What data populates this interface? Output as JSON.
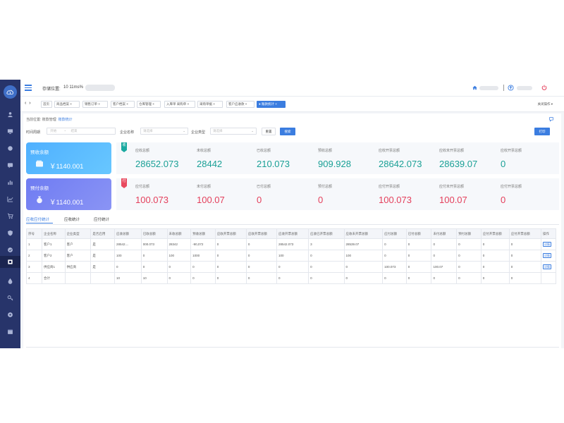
{
  "header": {
    "label": "存储位置:",
    "time": "10 11ms%",
    "user_name": ""
  },
  "tabbar": {
    "tabs": [
      "首页",
      "商品档案 ×",
      "销售订单 ×",
      "客户档案 ×",
      "仓库管理 ×",
      "入库单 采购单 ×",
      "采购单据 ×",
      "客户应收款 ×",
      "● 账款统计 ×"
    ],
    "close_all": "关闭操作 ▾"
  },
  "breadcrumb": {
    "label": "当前位置:",
    "parent": "账款管理",
    "current": "账款统计"
  },
  "filters": {
    "date_label": "时间周期",
    "date_start_placeholder": "开始",
    "date_sep": "-",
    "date_end_placeholder": "结束",
    "company_label": "企业名称",
    "company_placeholder": "请选择",
    "type_label": "企业类型",
    "type_placeholder": "请选择",
    "reset": "重置",
    "search": "搜索",
    "print": "打印"
  },
  "balances": [
    {
      "title": "预收余额",
      "amount": "￥1140.001",
      "icon": "wallet-icon"
    },
    {
      "title": "预付余额",
      "amount": "￥1140.001",
      "icon": "money-bag-icon"
    }
  ],
  "stats": {
    "receivable_badge": "收",
    "payable_badge": "付",
    "receivable": [
      {
        "label": "应收总额",
        "value": "28652.073"
      },
      {
        "label": "未收总额",
        "value": "28442"
      },
      {
        "label": "已收总额",
        "value": "210.073"
      },
      {
        "label": "预收总额",
        "value": "909.928"
      },
      {
        "label": "应收开票总额",
        "value": "28642.073"
      },
      {
        "label": "应收未开票总额",
        "value": "28639.07"
      },
      {
        "label": "应收开票总额",
        "value": "0"
      }
    ],
    "payable": [
      {
        "label": "应付总额",
        "value": "100.073"
      },
      {
        "label": "未付总额",
        "value": "100.07"
      },
      {
        "label": "已付总额",
        "value": "0"
      },
      {
        "label": "预付总额",
        "value": "0"
      },
      {
        "label": "应付开票总额",
        "value": "100.073"
      },
      {
        "label": "应付未开票总额",
        "value": "100.07"
      },
      {
        "label": "应付开票总额",
        "value": "0"
      }
    ]
  },
  "subtabs": [
    "应收应付统计",
    "应收统计",
    "应付统计"
  ],
  "table": {
    "columns": [
      "序号",
      "企业名称",
      "企业类型",
      "是否启用",
      "应收总额",
      "已收总额",
      "未收总额",
      "预收总额",
      "应收开票总额",
      "应收开票总额",
      "应收开票总额",
      "应收已开票总额",
      "应收未开票总额",
      "应付总额",
      "已付总额",
      "未付总额",
      "预付总额",
      "应付开票总额",
      "应付开票总额",
      "操作"
    ],
    "rows": [
      [
        "1",
        "客户1",
        "客户",
        "是",
        "28542....",
        "000.073",
        "28342",
        "-90,072",
        "0",
        "0",
        "28542.073",
        "3",
        "28539.07",
        "0",
        "0",
        "0",
        "0",
        "0",
        "0",
        "详情"
      ],
      [
        "2",
        "客户2",
        "客户",
        "是",
        "100",
        "0",
        "100",
        "1000",
        "0",
        "0",
        "100",
        "0",
        "100",
        "0",
        "0",
        "0",
        "0",
        "0",
        "0",
        "详情"
      ],
      [
        "3",
        "供应商1",
        "供应商",
        "是",
        "0",
        "0",
        "0",
        "0",
        "0",
        "0",
        "0",
        "0",
        "0",
        "100.073",
        "0",
        "100.07",
        "0",
        "0",
        "0",
        "详情"
      ],
      [
        "4",
        "合计",
        "",
        "",
        "10",
        "10",
        "0",
        "0",
        "0",
        "0",
        "0",
        "0",
        "0",
        "0",
        "0",
        "0",
        "0",
        "0",
        "0",
        ""
      ]
    ]
  },
  "colors": {
    "sidebar": "#27346a",
    "accent": "#3b7de0",
    "receivable": "#1aa096",
    "payable": "#e4405c"
  }
}
